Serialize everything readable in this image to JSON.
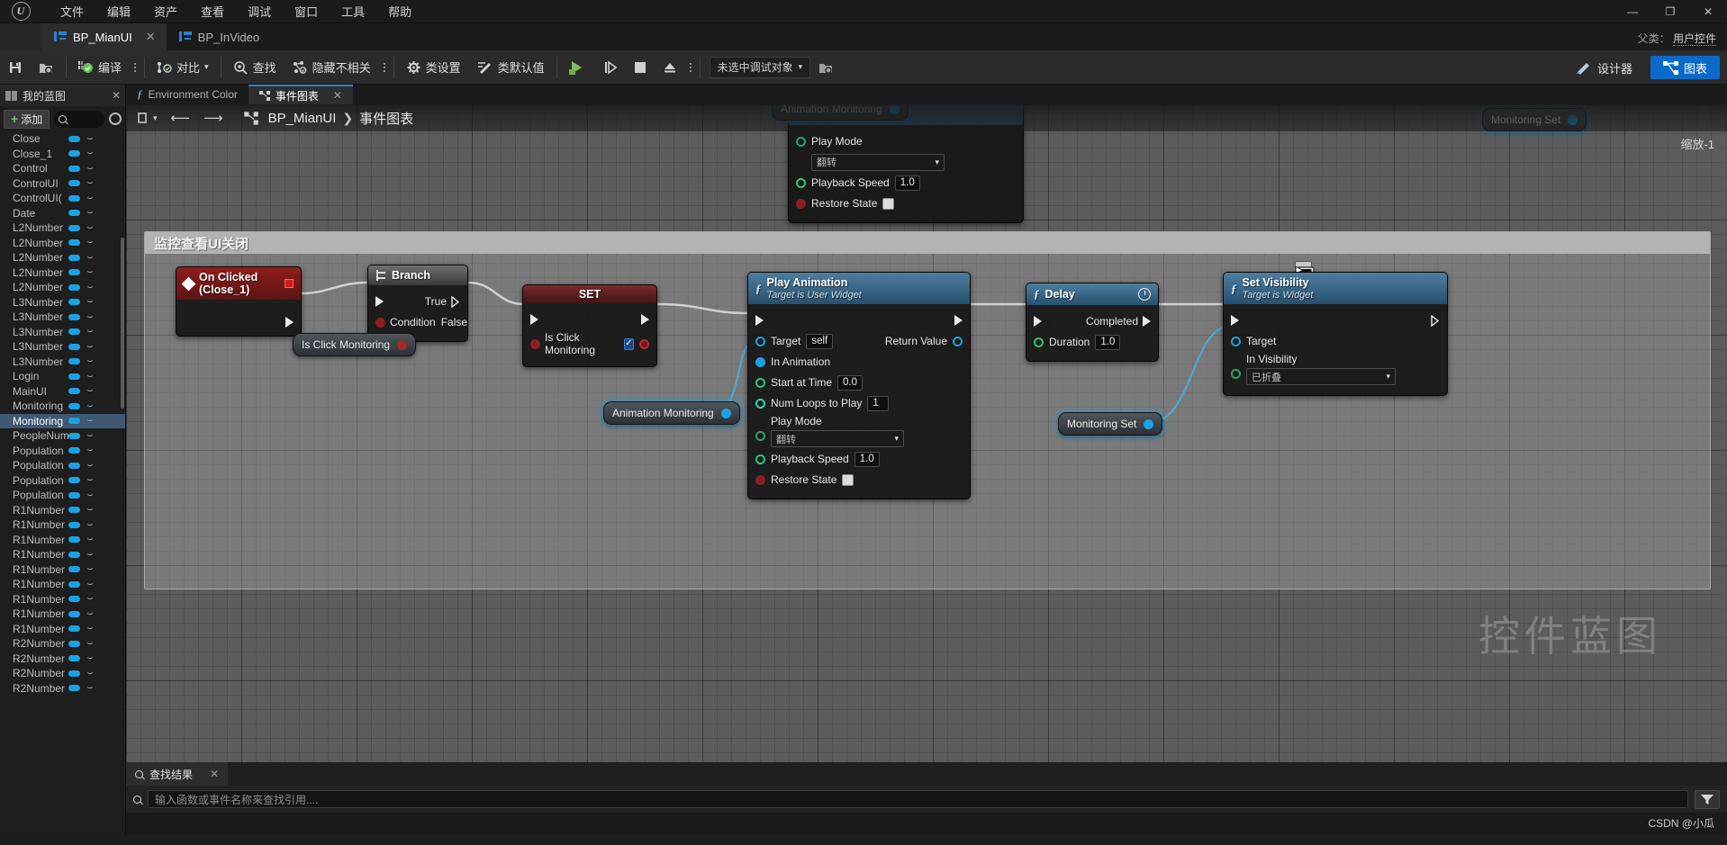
{
  "window": {
    "menu": [
      "文件",
      "编辑",
      "资产",
      "查看",
      "调试",
      "窗口",
      "工具",
      "帮助"
    ],
    "minimize": "—",
    "maximize": "❐",
    "close": "✕",
    "parent_class_label": "父类：",
    "parent_class_value": "用户控件"
  },
  "asset_tabs": [
    {
      "label": "BP_MianUI",
      "active": true,
      "close": "✕"
    },
    {
      "label": "BP_InVideo",
      "active": false,
      "close": ""
    }
  ],
  "toolbar": {
    "save": "save-icon",
    "browse": "browse-icon",
    "compile": "编译",
    "diff": "对比",
    "find": "查找",
    "hide_unrelated": "隐藏不相关",
    "class_settings": "类设置",
    "class_defaults": "类默认值",
    "play": "▶",
    "step": "▶|",
    "stop": "■",
    "eject": "⏏",
    "debug_object": "未选中调试对象",
    "designer": "设计器",
    "graph": "图表"
  },
  "my_blueprint": {
    "title": "我的蓝图",
    "add_label": "添加",
    "search_placeholder": "",
    "close": "✕",
    "items": [
      {
        "name": "Close",
        "selected": false
      },
      {
        "name": "Close_1",
        "selected": false
      },
      {
        "name": "Control",
        "selected": false
      },
      {
        "name": "ControlUI",
        "selected": false
      },
      {
        "name": "ControlUI(",
        "selected": false
      },
      {
        "name": "Date",
        "selected": false
      },
      {
        "name": "L2Number",
        "selected": false
      },
      {
        "name": "L2Number",
        "selected": false
      },
      {
        "name": "L2Number",
        "selected": false
      },
      {
        "name": "L2Number",
        "selected": false
      },
      {
        "name": "L2Number",
        "selected": false
      },
      {
        "name": "L3Number",
        "selected": false
      },
      {
        "name": "L3Number",
        "selected": false
      },
      {
        "name": "L3Number",
        "selected": false
      },
      {
        "name": "L3Number",
        "selected": false
      },
      {
        "name": "L3Number",
        "selected": false
      },
      {
        "name": "Login",
        "selected": false
      },
      {
        "name": "MainUI",
        "selected": false
      },
      {
        "name": "Monitoring",
        "selected": false
      },
      {
        "name": "Monitoring",
        "selected": true
      },
      {
        "name": "PeopleNum",
        "selected": false
      },
      {
        "name": "Population",
        "selected": false
      },
      {
        "name": "Population",
        "selected": false
      },
      {
        "name": "Population",
        "selected": false
      },
      {
        "name": "Population",
        "selected": false
      },
      {
        "name": "R1Number",
        "selected": false
      },
      {
        "name": "R1Number",
        "selected": false
      },
      {
        "name": "R1Number",
        "selected": false
      },
      {
        "name": "R1Number",
        "selected": false
      },
      {
        "name": "R1Number",
        "selected": false
      },
      {
        "name": "R1Number",
        "selected": false
      },
      {
        "name": "R1Number",
        "selected": false
      },
      {
        "name": "R1Number",
        "selected": false
      },
      {
        "name": "R1Number",
        "selected": false
      },
      {
        "name": "R2Number",
        "selected": false
      },
      {
        "name": "R2Number",
        "selected": false
      },
      {
        "name": "R2Number",
        "selected": false
      },
      {
        "name": "R2Number",
        "selected": false
      }
    ]
  },
  "graph_tabs": [
    {
      "label": "Environment Color",
      "active": false,
      "icon": "function-icon"
    },
    {
      "label": "事件图表",
      "active": true,
      "icon": "graph-icon",
      "close": "✕"
    }
  ],
  "breadcrumb": {
    "root": "BP_MianUI",
    "separator": "❯",
    "leaf": "事件图表",
    "back": "⟵",
    "forward": "⟶"
  },
  "zoom_label": "缩放-1",
  "watermark": "控件蓝图",
  "comment_box": {
    "title": "监控查看UI关闭"
  },
  "nodes": {
    "partial_play_animation": {
      "play_mode_label": "Play Mode",
      "play_mode_value": "翻转",
      "playback_speed_label": "Playback Speed",
      "playback_speed_value": "1.0",
      "restore_state_label": "Restore State"
    },
    "on_clicked": {
      "title": "On Clicked (Close_1)"
    },
    "branch": {
      "title": "Branch",
      "true_label": "True",
      "false_label": "False",
      "condition_label": "Condition"
    },
    "is_click_monitoring_get": {
      "label": "Is Click Monitoring"
    },
    "set_node": {
      "title": "SET",
      "pin_label": "Is Click Monitoring",
      "checked": true
    },
    "animation_monitoring_var": {
      "label": "Animation Monitoring"
    },
    "play_animation": {
      "title": "Play Animation",
      "subtitle": "Target is User Widget",
      "target_label": "Target",
      "target_value": "self",
      "in_animation_label": "In Animation",
      "start_at_time_label": "Start at Time",
      "start_at_time_value": "0.0",
      "num_loops_label": "Num Loops to Play",
      "num_loops_value": "1",
      "play_mode_label": "Play Mode",
      "play_mode_value": "翻转",
      "playback_speed_label": "Playback Speed",
      "playback_speed_value": "1.0",
      "restore_state_label": "Restore State",
      "return_value_label": "Return Value"
    },
    "delay": {
      "title": "Delay",
      "completed_label": "Completed",
      "duration_label": "Duration",
      "duration_value": "1.0"
    },
    "monitoring_set_var": {
      "label": "Monitoring Set"
    },
    "monitoring_set_var_top": {
      "label": "Monitoring Set"
    },
    "animation_monitoring_top": {
      "label": "Animation Monitoring"
    },
    "set_visibility": {
      "title": "Set Visibility",
      "subtitle": "Target is Widget",
      "target_label": "Target",
      "in_visibility_label": "In Visibility",
      "in_visibility_value": "已折叠"
    }
  },
  "find_results": {
    "tab_label": "查找结果",
    "close": "✕",
    "input_placeholder": "输入函数或事件名称来查找引用...."
  },
  "status": {
    "credit": "CSDN @小瓜"
  }
}
